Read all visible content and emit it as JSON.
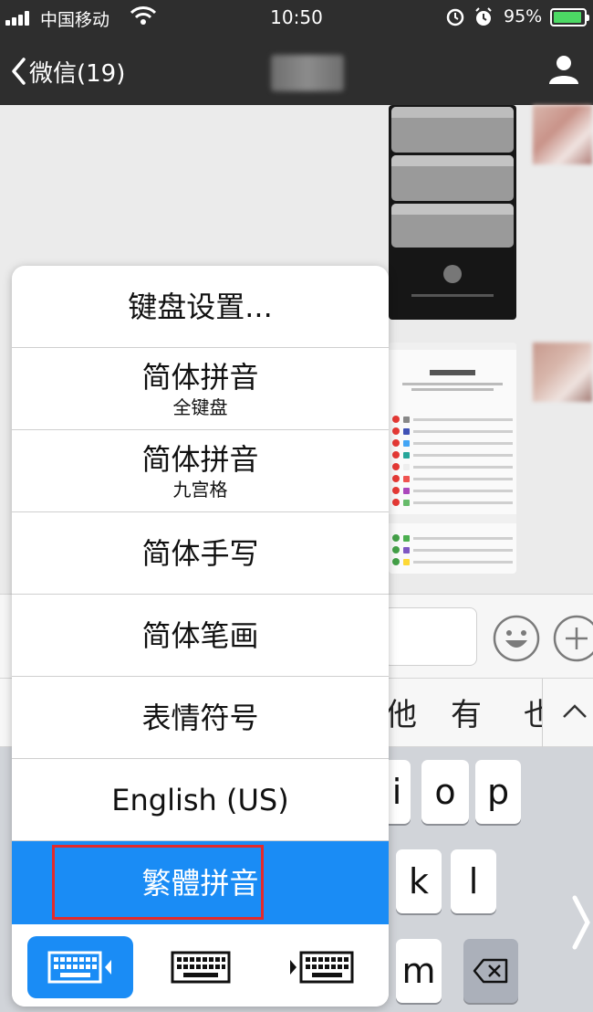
{
  "status_bar": {
    "carrier": "中国移动",
    "time": "10:50",
    "battery_percent": "95%",
    "battery_level": 0.95,
    "battery_color": "#4cd964"
  },
  "nav": {
    "back_label": "微信(19)",
    "back_icon": "chevron-left-icon",
    "profile_icon": "person-icon"
  },
  "candidates": [
    "他",
    "有",
    "也"
  ],
  "keyboard": {
    "keys": [
      "i",
      "o",
      "p",
      "k",
      "l",
      "m"
    ],
    "delete_icon": "backspace-icon"
  },
  "language_menu": {
    "items": [
      {
        "main": "键盘设置...",
        "sub": ""
      },
      {
        "main": "简体拼音",
        "sub": "全键盘"
      },
      {
        "main": "简体拼音",
        "sub": "九宫格"
      },
      {
        "main": "简体手写",
        "sub": ""
      },
      {
        "main": "简体笔画",
        "sub": ""
      },
      {
        "main": "表情符号",
        "sub": ""
      },
      {
        "main": "English (US)",
        "sub": ""
      },
      {
        "main": "繁體拼音",
        "sub": ""
      }
    ],
    "selected_index": 7,
    "selected_color": "#1a8cf5",
    "highlight_color": "#e42a2a",
    "layout_buttons": [
      "keyboard-left-icon",
      "keyboard-full-icon",
      "keyboard-right-icon"
    ]
  }
}
